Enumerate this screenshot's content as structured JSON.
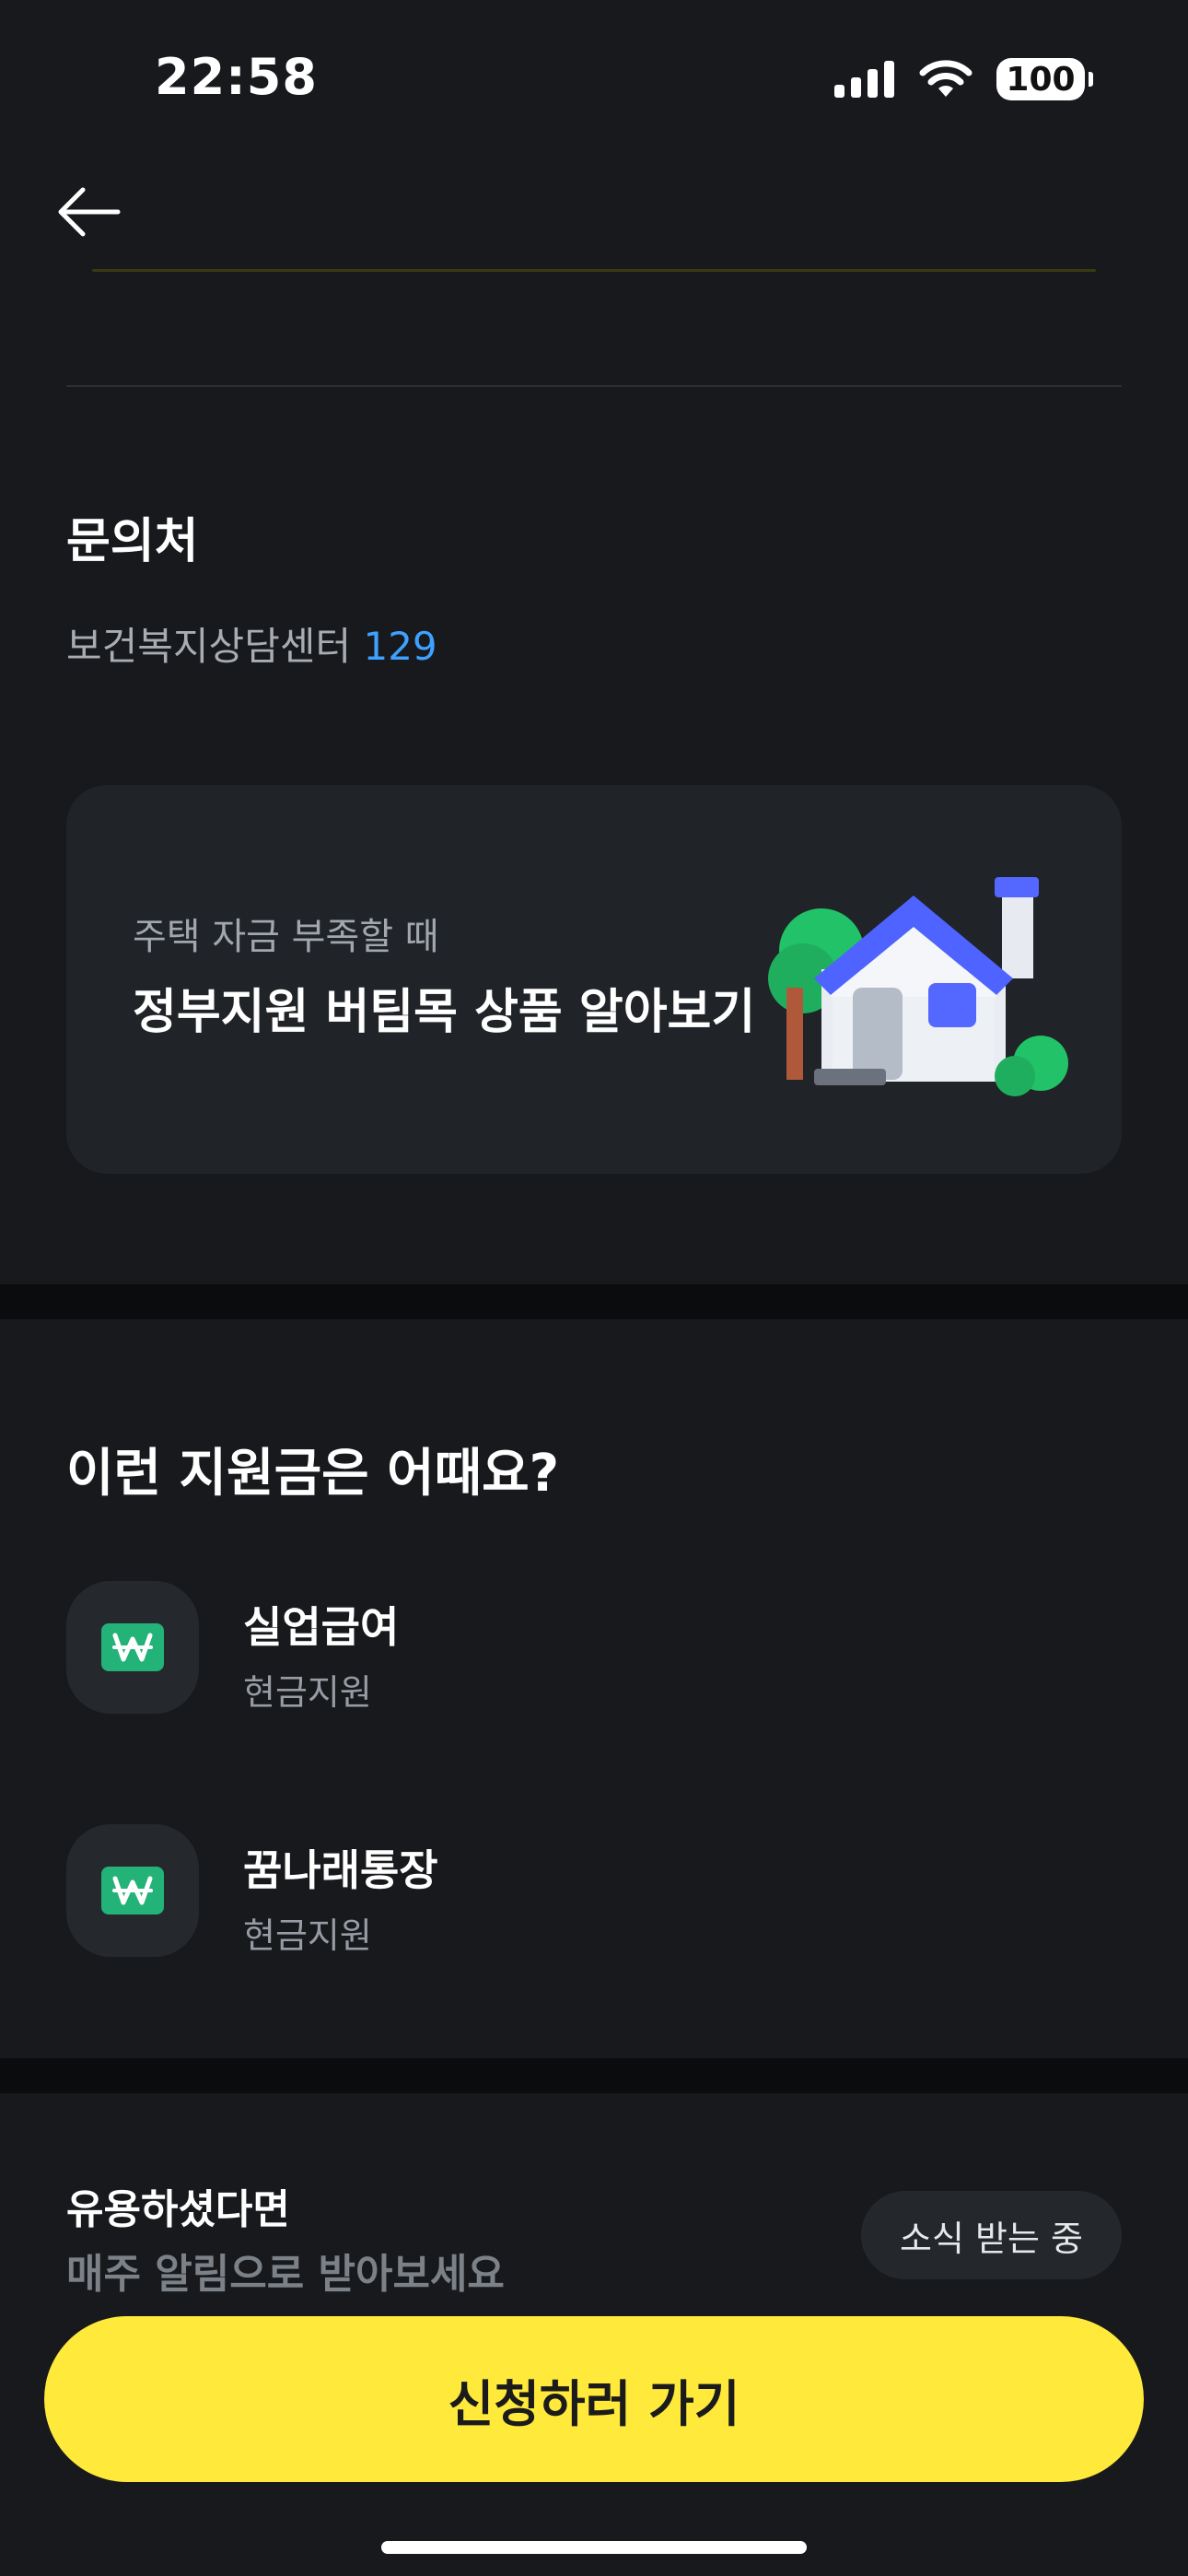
{
  "status_bar": {
    "time": "22:58",
    "battery": "100"
  },
  "contact": {
    "title": "문의처",
    "center": "보건복지상담센터",
    "phone": "129"
  },
  "promo_card": {
    "subtitle": "주택 자금 부족할 때",
    "title": "정부지원 버팀목 상품 알아보기"
  },
  "recommend": {
    "title": "이런 지원금은 어때요?",
    "items": [
      {
        "name": "실업급여",
        "tag": "현금지원",
        "icon": "won-icon"
      },
      {
        "name": "꿈나래통장",
        "tag": "현금지원",
        "icon": "won-icon"
      }
    ]
  },
  "subscribe": {
    "title": "유용하셨다면",
    "subtitle": "매주 알림으로 받아보세요",
    "button": "소식 받는 중"
  },
  "cta": {
    "label": "신청하러 가기"
  },
  "colors": {
    "accent_yellow": "#ffe93a",
    "link_blue": "#3ea1ff",
    "won_green": "#23b378"
  }
}
